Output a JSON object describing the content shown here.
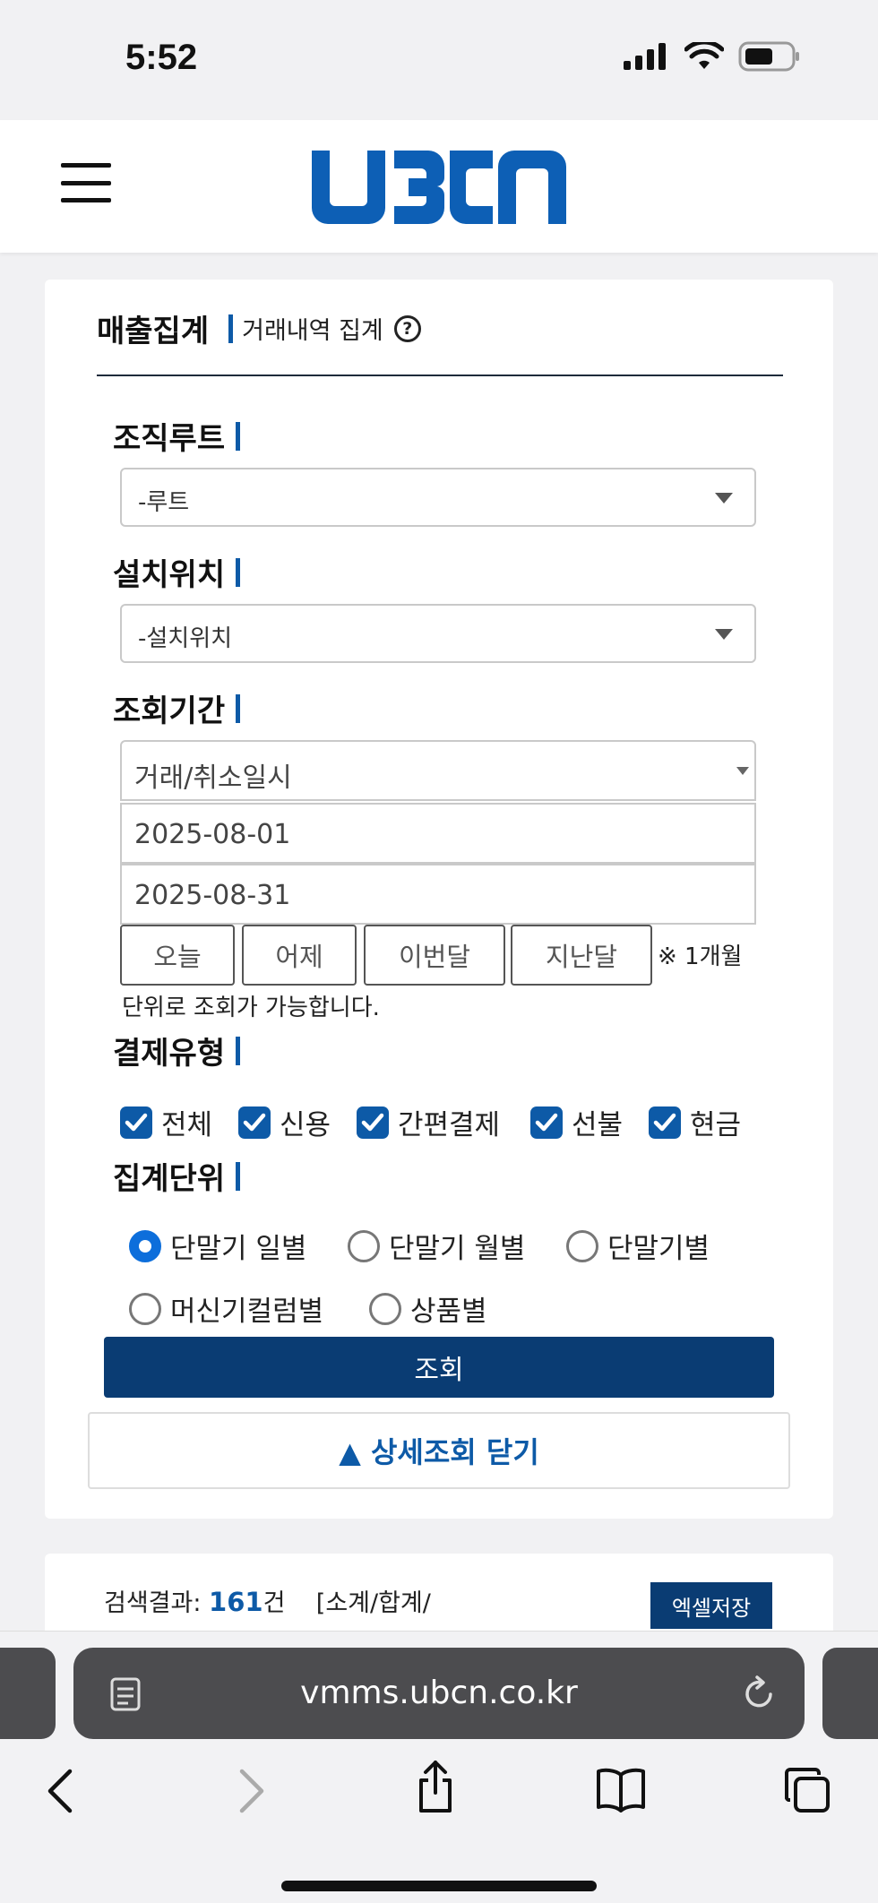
{
  "status_bar": {
    "time": "5:52"
  },
  "header": {
    "logo_text": "UBCN"
  },
  "card": {
    "title": "매출집계",
    "subtitle": "거래내역 집계",
    "help_glyph": "?"
  },
  "sections": {
    "org_root": {
      "label": "조직루트",
      "value": "-루트"
    },
    "install_location": {
      "label": "설치위치",
      "value": "-설치위치"
    },
    "period": {
      "label": "조회기간",
      "type_value": "거래/취소일시",
      "start_date": "2025-08-01",
      "end_date": "2025-08-31",
      "buttons": [
        "오늘",
        "어제",
        "이번달",
        "지난달"
      ],
      "note_line1": "※ 1개월",
      "note_line2": "단위로 조회가 가능합니다."
    },
    "payment_type": {
      "label": "결제유형",
      "options": [
        "전체",
        "신용",
        "간편결제",
        "선불",
        "현금"
      ]
    },
    "aggregation_unit": {
      "label": "집계단위",
      "options": [
        "단말기 일별",
        "단말기 월별",
        "단말기별",
        "머신기컬럼별",
        "상품별"
      ],
      "selected": "단말기 일별"
    }
  },
  "actions": {
    "search_label": "조회",
    "detail_close_label": "▲ 상세조회 닫기"
  },
  "results": {
    "prefix": "검색결과: ",
    "count": "161",
    "suffix": "건",
    "columns_hint": "[소계/합계/",
    "excel_label": "엑셀저장"
  },
  "browser": {
    "url": "vmms.ubcn.co.kr"
  },
  "colors": {
    "accent": "#0d5aa7",
    "primary_button": "#0a3c73",
    "checkbox": "#0d5aa7",
    "radio_on": "#0d6edb"
  }
}
